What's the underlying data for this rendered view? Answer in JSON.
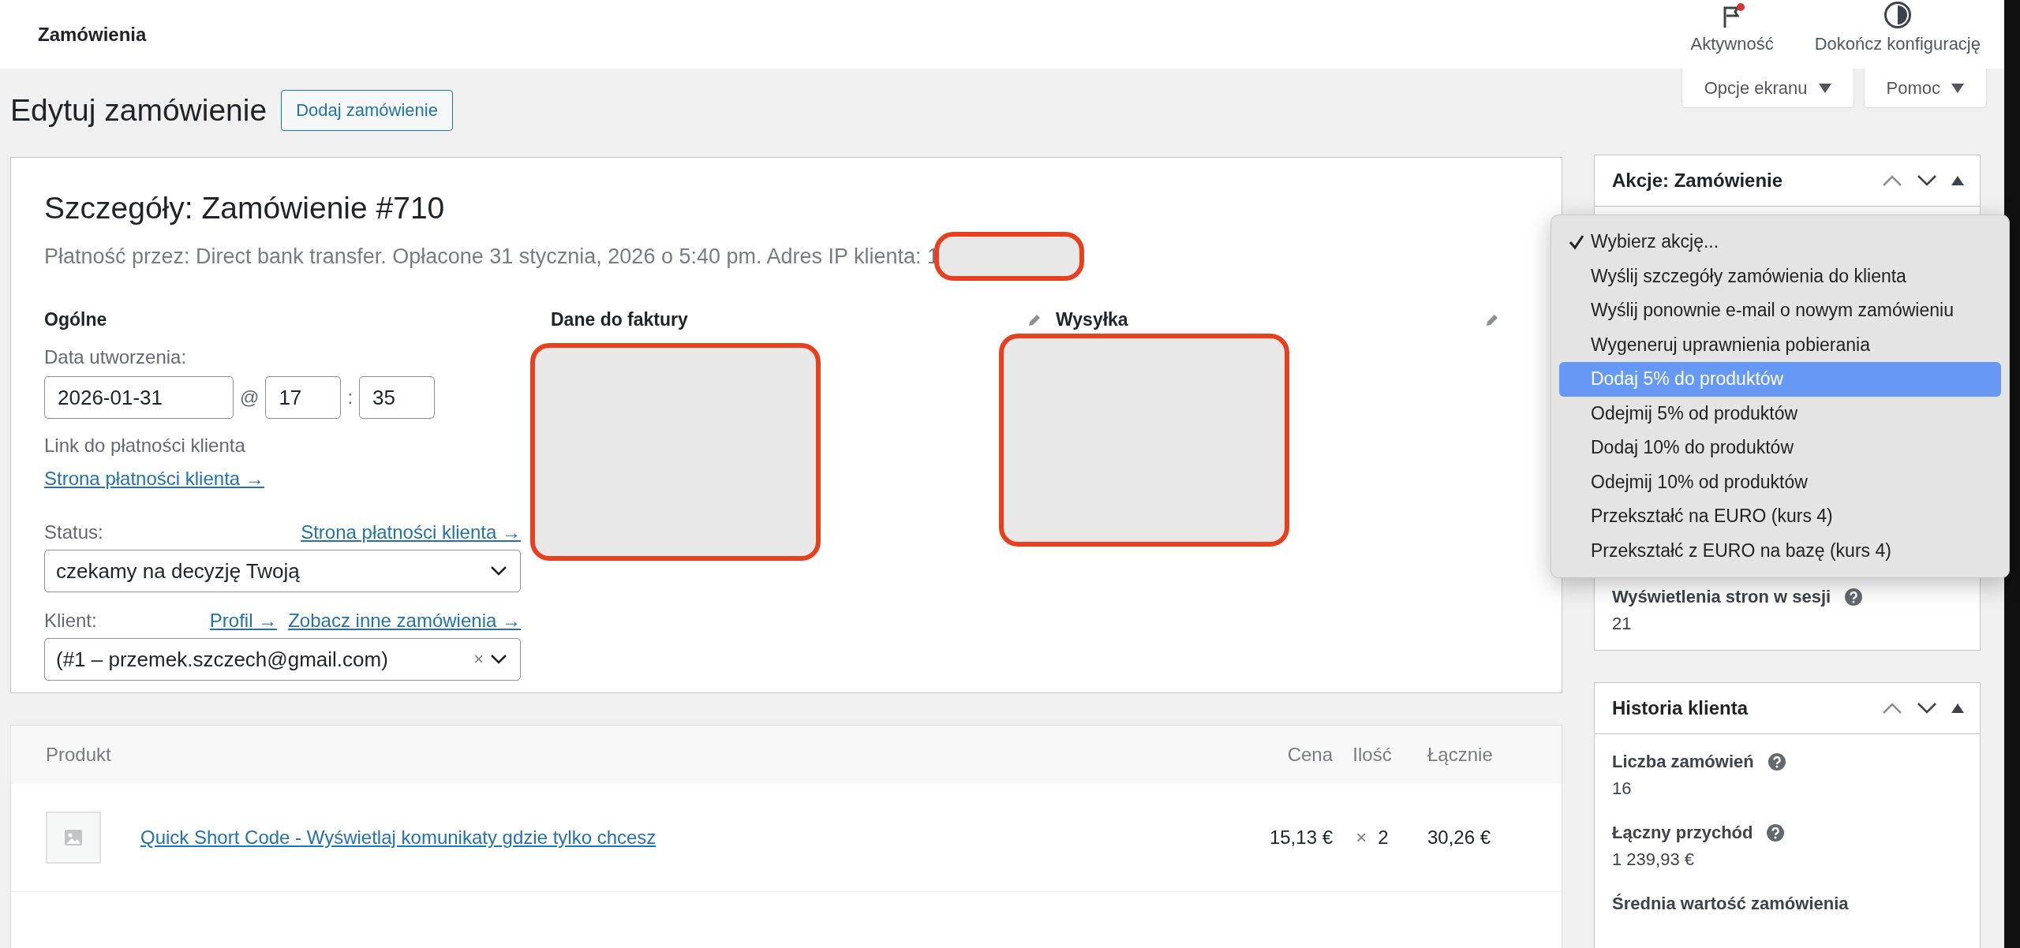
{
  "top_bar": {
    "title": "Zamówienia",
    "actions": [
      {
        "label": "Aktywność",
        "kind": "flag",
        "notification": true
      },
      {
        "label": "Dokończ konfigurację",
        "kind": "progress",
        "notification": false
      }
    ]
  },
  "screen_buttons": [
    "Opcje ekranu",
    "Pomoc"
  ],
  "page": {
    "title": "Edytuj zamówienie",
    "add_button": "Dodaj zamówienie"
  },
  "order": {
    "title": "Szczegóły: Zamówienie #710",
    "meta": "Płatność przez: Direct bank transfer. Opłacone 31 stycznia, 2026 o 5:40 pm. Adres IP klienta: 1",
    "meta_redacted": true,
    "general": {
      "heading": "Ogólne",
      "date_label": "Data utworzenia:",
      "date": "2026-01-31",
      "at": "@",
      "hour": "17",
      "colon": ":",
      "minute": "35",
      "payment_link_label": "Link do płatności klienta",
      "payment_link": "Strona płatności klienta →",
      "status_label": "Status:",
      "status_link": "Strona płatności klienta →",
      "status": "czekamy na decyzję Twoją",
      "customer_label": "Klient:",
      "customer_links": [
        "Profil →",
        "Zobacz inne zamówienia →"
      ],
      "customer": "(#1 – przemek.szczech@gmail.com)",
      "clear": "×"
    },
    "billing": {
      "heading": "Dane do faktury",
      "redacted": true
    },
    "shipping": {
      "heading": "Wysyłka",
      "redacted": true
    }
  },
  "items": {
    "columns": [
      "Produkt",
      "Cena",
      "Ilość",
      "Łącznie"
    ],
    "rows": [
      {
        "name": "Quick Short Code - Wyświetlaj komunikaty gdzie tylko chcesz",
        "price": "15,13 €",
        "times": "×",
        "qty": "2",
        "total": "30,26 €"
      }
    ]
  },
  "sidebar": [
    {
      "title": "Akcje: Zamówienie",
      "fields": [
        {
          "label": "Wyświetlenia stron w sesji",
          "value": "21"
        }
      ]
    },
    {
      "title": "Historia klienta",
      "fields": [
        {
          "label": "Liczba zamówień",
          "value": "16"
        },
        {
          "label": "Łączny przychód",
          "value": "1 239,93 €"
        },
        {
          "label": "Średnia wartość zamówienia"
        }
      ]
    }
  ],
  "action_menu": {
    "items": [
      {
        "label": "Wybierz akcję...",
        "checked": true,
        "selected": false
      },
      {
        "label": "Wyślij szczegóły zamówienia do klienta",
        "checked": false,
        "selected": false
      },
      {
        "label": "Wyślij ponownie e-mail o nowym zamówieniu",
        "checked": false,
        "selected": false
      },
      {
        "label": "Wygeneruj uprawnienia pobierania",
        "checked": false,
        "selected": false
      },
      {
        "label": "Dodaj 5% do produktów",
        "checked": false,
        "selected": true
      },
      {
        "label": "Odejmij 5% od produktów",
        "checked": false,
        "selected": false
      },
      {
        "label": "Dodaj 10% do produktów",
        "checked": false,
        "selected": false
      },
      {
        "label": "Odejmij 10% od produktów",
        "checked": false,
        "selected": false
      },
      {
        "label": "Przekształć na EURO (kurs 4)",
        "checked": false,
        "selected": false
      },
      {
        "label": "Przekształć z EURO na bazę (kurs 4)",
        "checked": false,
        "selected": false
      }
    ]
  }
}
